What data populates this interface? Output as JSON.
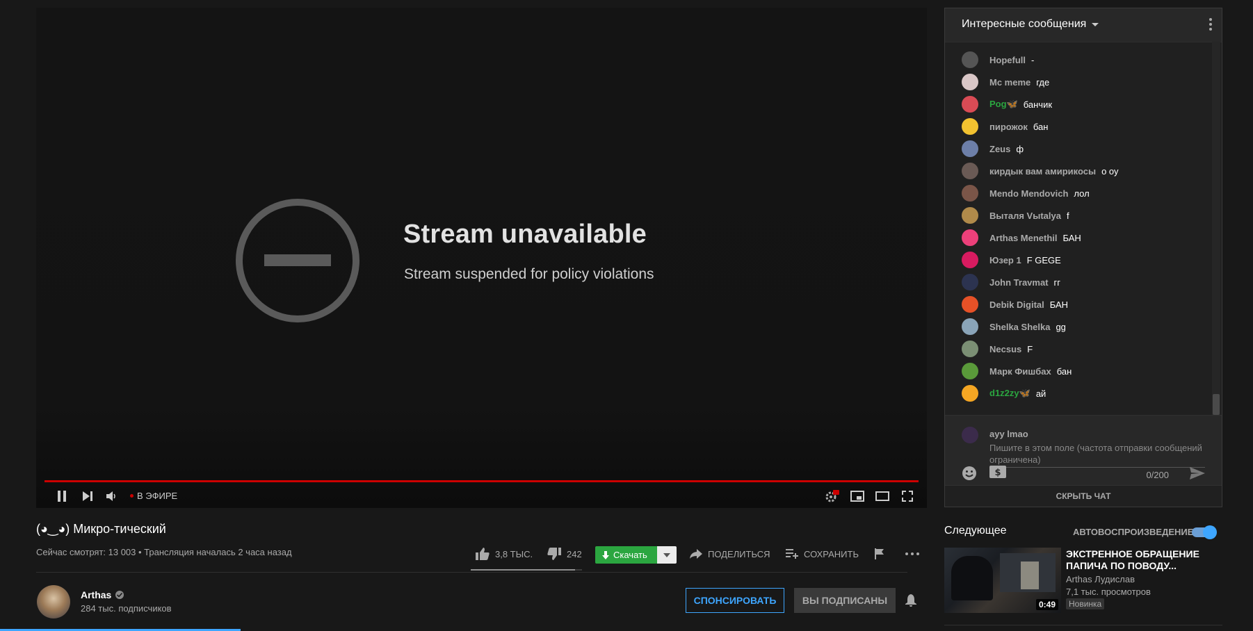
{
  "player": {
    "error_title": "Stream unavailable",
    "error_subtitle": "Stream suspended for policy violations",
    "live_label": "В ЭФИРЕ",
    "live_color": "#cc0000",
    "icons": [
      "pause-icon",
      "next-icon",
      "volume-icon",
      "settings-hd-icon",
      "miniplayer-icon",
      "theater-icon",
      "fullscreen-icon"
    ]
  },
  "video": {
    "title": "(◕‿◕) Микро-тический",
    "meta": "Сейчас смотрят: 13 003 • Трансляция началась 2 часа назад",
    "likes": "3,8 ТЫС.",
    "dislikes": "242",
    "like_ratio": 0.94,
    "download_label": "Скачать",
    "share_label": "ПОДЕЛИТЬСЯ",
    "save_label": "СОХРАНИТЬ"
  },
  "channel": {
    "name": "Arthas",
    "subscribers": "284 тыс. подписчиков",
    "sponsor_label": "СПОНСИРОВАТЬ",
    "subscribed_label": "ВЫ ПОДПИСАНЫ"
  },
  "chat": {
    "mode_label": "Интересные сообщения",
    "messages": [
      {
        "author": "Hopefull",
        "text": "-",
        "green": false,
        "color": "#555"
      },
      {
        "author": "Mc meme",
        "text": "где",
        "green": false,
        "color": "#d9c7c7"
      },
      {
        "author": "Pog🦋",
        "text": "банчик",
        "green": true,
        "color": "#d94b55"
      },
      {
        "author": "пирожок",
        "text": "бан",
        "green": false,
        "color": "#f2c230"
      },
      {
        "author": "Zeus",
        "text": "ф",
        "green": false,
        "color": "#6d7fa8"
      },
      {
        "author": "кирдык вам амирикосы",
        "text": "о оу",
        "green": false,
        "color": "#6a5a55"
      },
      {
        "author": "Mendo Mendovich",
        "text": "лол",
        "green": false,
        "color": "#7a5548"
      },
      {
        "author": "Выталя Vыtalya",
        "text": "f",
        "green": false,
        "color": "#b08a4a"
      },
      {
        "author": "Arthas Menethil",
        "text": "БАН",
        "green": false,
        "color": "#ec407a"
      },
      {
        "author": "Юзер 1",
        "text": "F GEGE",
        "green": false,
        "color": "#d81b60"
      },
      {
        "author": "John Travmat",
        "text": "гг",
        "green": false,
        "color": "#2c3350"
      },
      {
        "author": "Debik Digital",
        "text": "БАН",
        "green": false,
        "color": "#e65127"
      },
      {
        "author": "Shelka Shelka",
        "text": "gg",
        "green": false,
        "color": "#8aa4b8"
      },
      {
        "author": "Necsus",
        "text": "F",
        "green": false,
        "color": "#7b8f74"
      },
      {
        "author": "Марк Фишбах",
        "text": "бан",
        "green": false,
        "color": "#5a9a3a"
      },
      {
        "author": "d1z2zy🦋",
        "text": "ай",
        "green": true,
        "color": "#f5a623"
      }
    ],
    "my_name": "ayy lmao",
    "input_placeholder": "Пишите в этом поле (частота отправки сообщений ограничена)",
    "char_count": "0/200",
    "hide_label": "СКРЫТЬ ЧАТ"
  },
  "upnext": {
    "title": "Следующее",
    "autoplay_label": "АВТОВОСПРОИЗВЕДЕНИЕ",
    "autoplay_on": true,
    "video_title": "ЭКСТРЕННОЕ ОБРАЩЕНИЕ ПАПИЧА ПО ПОВОДУ...",
    "video_channel": "Arthas Лудислав",
    "video_views": "7,1 тыс. просмотров",
    "video_badge": "Новинка",
    "video_duration": "0:49"
  },
  "colors": {
    "accent": "#3ea6ff",
    "download": "#2ba640",
    "progress": "#cc0000"
  }
}
